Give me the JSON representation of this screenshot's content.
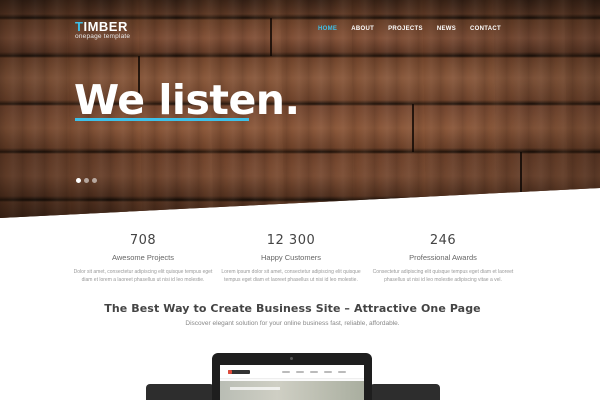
{
  "brand": {
    "first_letter": "T",
    "rest": "IMBER",
    "tagline": "onepage template"
  },
  "nav": [
    {
      "label": "HOME",
      "active": true
    },
    {
      "label": "ABOUT",
      "active": false
    },
    {
      "label": "PROJECTS",
      "active": false
    },
    {
      "label": "NEWS",
      "active": false
    },
    {
      "label": "CONTACT",
      "active": false
    }
  ],
  "hero": {
    "headline": "We listen.",
    "slider_dots": {
      "count": 3,
      "active_index": 0
    }
  },
  "stats": [
    {
      "value": "708",
      "title": "Awesome Projects",
      "text": "Dolor sit amet, consectetur adipiscing elit quisque tempus eget diam et lorem a laoreet phasellus ut nisi id leo molestie."
    },
    {
      "value": "12 300",
      "title": "Happy Customers",
      "text": "Lorem ipsum dolor sit amet, consectetur adipiscing elit quisque tempus eget diam et laoreet phasellus ut nisi id leo molestie."
    },
    {
      "value": "246",
      "title": "Professional Awards",
      "text": "Consectetur adipiscing elit quisque tempus eget diam et laoreet phasellus ut nisi id leo molestie adipiscing vitae a vel."
    }
  ],
  "section": {
    "title": "The Best Way to Create Business Site – Attractive One Page",
    "subtitle": "Discover elegant solution for your online business fast, reliable, affordable."
  },
  "colors": {
    "accent": "#3ec0e8",
    "wood": "#6b412a",
    "device": "#1e1e1e"
  },
  "icons": {
    "slider_dot": "circle"
  }
}
